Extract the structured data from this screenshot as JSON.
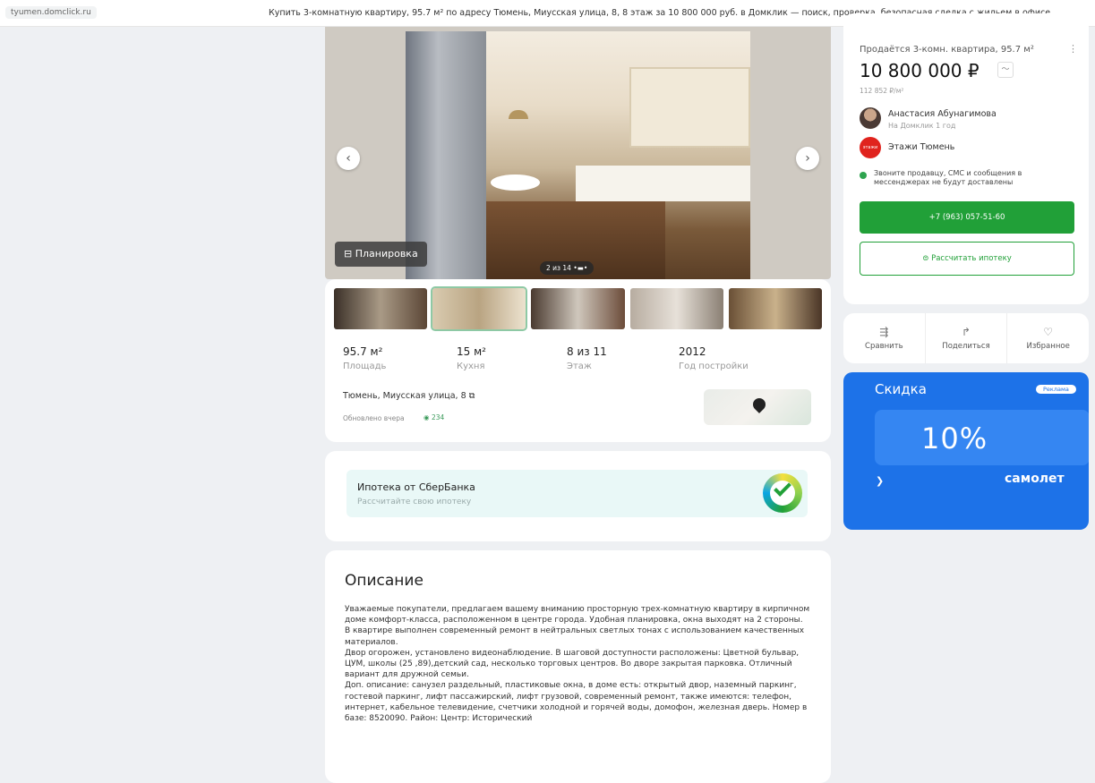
{
  "browser": {
    "url": "tyumen.domclick.ru",
    "title": "Купить 3-комнатную квартиру, 95.7 м² по адресу Тюмень, Миусская улица, 8, 8 этаж за 10 800 000 руб. в Домклик — поиск, проверка, безопасная сделка с жильем в офисе"
  },
  "gallery": {
    "plan_label": "Планировка",
    "counter": "2 из 14",
    "prev": "‹",
    "next": "›"
  },
  "stats": [
    {
      "value": "95.7 м²",
      "label": "Площадь"
    },
    {
      "value": "15 м²",
      "label": "Кухня"
    },
    {
      "value": "8 из 11",
      "label": "Этаж"
    },
    {
      "value": "2012",
      "label": "Год постройки"
    }
  ],
  "location": {
    "address": "Тюмень, Миусская улица, 8",
    "updated": "Обновлено вчера",
    "views": "234"
  },
  "sber": {
    "title": "Ипотека от СберБанка",
    "subtitle": "Рассчитайте свою ипотеку"
  },
  "description": {
    "title": "Описание",
    "paragraphs": [
      "Уважаемые покупатели, предлагаем вашему вниманию просторную трех-комнатную квартиру в кирпичном доме комфорт-класса, расположенном в центре города. Удобная планировка, окна выходят на 2 стороны. В квартире выполнен современный ремонт в нейтральных светлых тонах с использованием качественных материалов.",
      "Двор огорожен, установлено видеонаблюдение. В шаговой доступности расположены: Цветной бульвар, ЦУМ, школы (25 ,89),детский сад, несколько торговых центров. Во дворе закрытая парковка. Отличный вариант для дружной семьи.",
      "Доп. описание: санузел раздельный, пластиковые окна, в доме есть: открытый двор, наземный паркинг, гостевой паркинг, лифт пассажирский, лифт грузовой, современный ремонт, также имеются: телефон, интернет, кабельное телевидение, счетчики холодной и горячей воды, домофон, железная дверь. Номер в базе: 8520090. Район: Центр: Исторический"
    ]
  },
  "offer": {
    "label": "Продаётся 3-комн. квартира, 95.7 м²",
    "price": "10 800 000 ₽",
    "price_per_m2": "112 852 ₽/м²",
    "agent_name": "Анастасия Абунагимова",
    "agent_since": "На Домклик 1 год",
    "agency": "Этажи Тюмень",
    "notice": "Звоните продавцу, СМС и сообщения в мессенджерах не будут доставлены",
    "phone_button": "+7 (963) 057-51-60",
    "mortgage_button": "Рассчитать ипотеку"
  },
  "actions": [
    {
      "icon": "compare-icon",
      "label": "Сравнить"
    },
    {
      "icon": "share-icon",
      "label": "Поделиться"
    },
    {
      "icon": "heart-icon",
      "label": "Избранное"
    }
  ],
  "ad": {
    "title": "Скидка",
    "tag": "Реклама",
    "discount": "10%",
    "brand": "самолет",
    "accent_color": "#1d72e8"
  },
  "colors": {
    "green": "#21a038",
    "page_bg": "#eef0f3"
  }
}
